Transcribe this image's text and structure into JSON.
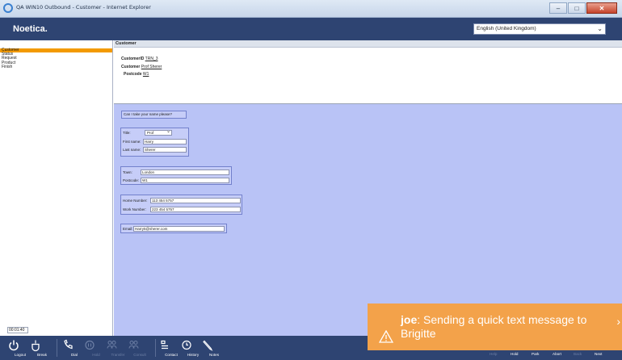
{
  "window": {
    "title": "QA WIN10 Outbound - Customer - Internet Explorer",
    "close_glyph": "✕",
    "max_glyph": "□",
    "min_glyph": "–"
  },
  "header": {
    "logo": "Noetica.",
    "language": "English (United Kingdom)"
  },
  "nav": {
    "items": [
      "Customer",
      "Status",
      "Request",
      "Product",
      "Finish"
    ],
    "active_index": 0,
    "timer": "00:01:40"
  },
  "customer": {
    "section_title": "Customer",
    "id_label": "CustomerID",
    "id_value": "TRN_3",
    "name_label": "Customer",
    "name_value": "Prof Sherer",
    "postcode_label": "Postcode",
    "postcode_value": "W1"
  },
  "form": {
    "question": "Can I take your name please?",
    "title_label": "Title:",
    "title_value": "Prof",
    "first_name_label": "First name:",
    "first_name_value": "Harry",
    "last_name_label": "Last name:",
    "last_name_value": "Sherer",
    "town_label": "Town:",
    "town_value": "London",
    "postcode_label": "Postcode:",
    "postcode_value": "W1",
    "home_number_label": "Home Number:",
    "home_number_value": "113 454 5757",
    "work_number_label": "Work Number:",
    "work_number_value": "223 454 5757",
    "email_label": "Email:",
    "email_value": "Harry5@sherer.com"
  },
  "toolbar": {
    "buttons": [
      {
        "label": "Logout",
        "icon": "power-icon",
        "enabled": true
      },
      {
        "label": "Break",
        "icon": "coffee-cup-icon",
        "enabled": true
      },
      {
        "label": "Dial",
        "icon": "phone-icon",
        "enabled": true
      },
      {
        "label": "Hold",
        "icon": "pause-icon",
        "enabled": false
      },
      {
        "label": "Transfer",
        "icon": "transfer-people-icon",
        "enabled": false
      },
      {
        "label": "Consult",
        "icon": "consult-people-icon",
        "enabled": false
      },
      {
        "label": "Contact",
        "icon": "contact-icon",
        "enabled": true
      },
      {
        "label": "History",
        "icon": "clock-icon",
        "enabled": true
      },
      {
        "label": "Notes",
        "icon": "pencil-icon",
        "enabled": true
      }
    ],
    "right": [
      {
        "label": "Help",
        "enabled": false
      },
      {
        "label": "Hold",
        "enabled": true
      },
      {
        "label": "Park",
        "enabled": true
      },
      {
        "label": "Abort",
        "enabled": true
      },
      {
        "label": "Back",
        "enabled": false
      },
      {
        "label": "Next",
        "enabled": true
      }
    ]
  },
  "toast": {
    "sender": "joe",
    "message": ": Sending a quick text message to Brigitte",
    "more_glyph": "›",
    "color": "#f3a24a"
  },
  "colors": {
    "header": "#2e4472",
    "nav_active": "#f39a00",
    "form_bg": "#b9c3f6"
  }
}
